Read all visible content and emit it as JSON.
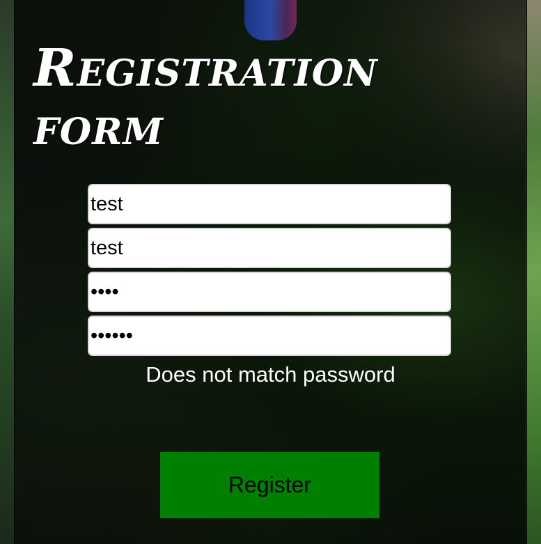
{
  "form": {
    "title": "Registration form",
    "fields": [
      {
        "name": "first",
        "value": "test",
        "type": "text"
      },
      {
        "name": "second",
        "value": "test",
        "type": "text"
      },
      {
        "name": "password",
        "value": "test",
        "type": "password"
      },
      {
        "name": "confirm_password",
        "value": "testtt",
        "type": "password"
      }
    ],
    "error_message": "Does not match password",
    "submit_label": "Register"
  },
  "colors": {
    "button": "#008000",
    "text": "#ffffff",
    "panel": "rgba(0,0,0,0.55)"
  }
}
